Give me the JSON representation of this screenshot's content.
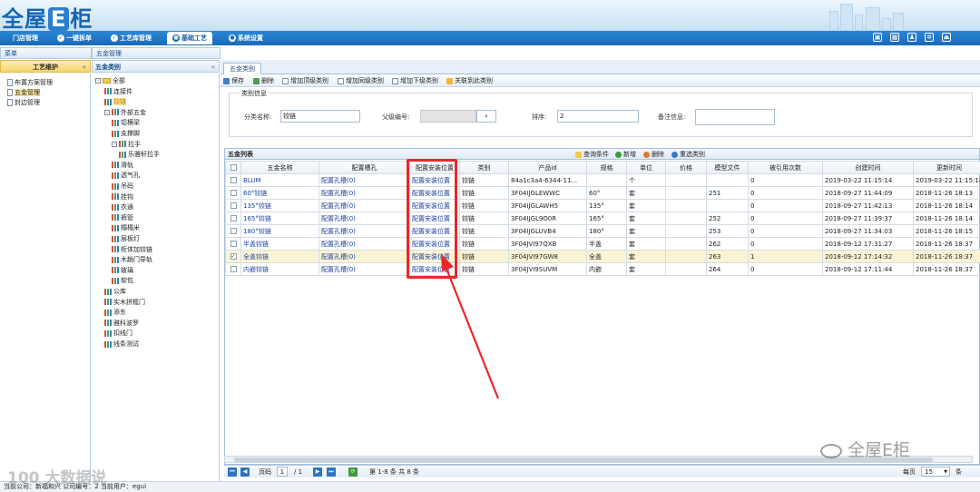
{
  "app": {
    "logo": "全屋E柜",
    "nav_tabs": [
      {
        "label": "门店管理",
        "icon": ""
      },
      {
        "label": "一键拆单",
        "icon": "check-icon"
      },
      {
        "label": "工艺库管理",
        "icon": "check-icon"
      },
      {
        "label": "基础工艺",
        "icon": "gear-icon",
        "active": true
      },
      {
        "label": "系统设置",
        "icon": "settings-icon"
      }
    ],
    "top_icons": [
      "layout-icon",
      "calendar-icon",
      "user-icon",
      "gear-icon",
      "exit-icon"
    ]
  },
  "left": {
    "menu_header": "菜单",
    "section": "工艺维护",
    "items": [
      {
        "label": "布置方案管理",
        "selected": false
      },
      {
        "label": "五金管理",
        "selected": true
      },
      {
        "label": "封边管理",
        "selected": false
      }
    ]
  },
  "tree": {
    "breadcrumb": "五金管理",
    "section": "五金类别",
    "nodes": [
      {
        "label": "全部",
        "level": 0,
        "toggle": "-",
        "icon": "folder"
      },
      {
        "label": "连接件",
        "level": 1,
        "toggle": "",
        "icon": "bars"
      },
      {
        "label": "铰链",
        "level": 1,
        "toggle": "",
        "icon": "bars",
        "selected": true
      },
      {
        "label": "外部五金",
        "level": 1,
        "toggle": "-",
        "icon": "bars"
      },
      {
        "label": "铝横梁",
        "level": 2,
        "toggle": "",
        "icon": "bars"
      },
      {
        "label": "支撑脚",
        "level": 2,
        "toggle": "",
        "icon": "bars"
      },
      {
        "label": "拉手",
        "level": 2,
        "toggle": "-",
        "icon": "bars"
      },
      {
        "label": "乐雅轩拉手",
        "level": 3,
        "toggle": "",
        "icon": "bars"
      },
      {
        "label": "滑轨",
        "level": 2,
        "toggle": "",
        "icon": "bars"
      },
      {
        "label": "透气孔",
        "level": 2,
        "toggle": "",
        "icon": "bars"
      },
      {
        "label": "吊码",
        "level": 2,
        "toggle": "",
        "icon": "bars"
      },
      {
        "label": "挂钩",
        "level": 2,
        "toggle": "",
        "icon": "bars"
      },
      {
        "label": "衣通",
        "level": 2,
        "toggle": "",
        "icon": "bars"
      },
      {
        "label": "裤管",
        "level": 2,
        "toggle": "",
        "icon": "bars"
      },
      {
        "label": "榻榻米",
        "level": 2,
        "toggle": "",
        "icon": "bars"
      },
      {
        "label": "层板灯",
        "level": 2,
        "toggle": "",
        "icon": "bars"
      },
      {
        "label": "柜体加铰链",
        "level": 2,
        "toggle": "",
        "icon": "bars"
      },
      {
        "label": "木趟门导轨",
        "level": 2,
        "toggle": "",
        "icon": "bars"
      },
      {
        "label": "玻璃",
        "level": 2,
        "toggle": "",
        "icon": "bars"
      },
      {
        "label": "软包",
        "level": 2,
        "toggle": "",
        "icon": "bars"
      },
      {
        "label": "公库",
        "level": 1,
        "toggle": "",
        "icon": "bars"
      },
      {
        "label": "实木拼框门",
        "level": 1,
        "toggle": "",
        "icon": "bars"
      },
      {
        "label": "添东",
        "level": 1,
        "toggle": "",
        "icon": "bars"
      },
      {
        "label": "雅科波罗",
        "level": 1,
        "toggle": "",
        "icon": "bars"
      },
      {
        "label": "扣线门",
        "level": 1,
        "toggle": "",
        "icon": "bars"
      },
      {
        "label": "线条测试",
        "level": 1,
        "toggle": "",
        "icon": "bars"
      }
    ]
  },
  "main": {
    "tab": "五金类别",
    "toolbar": [
      "保存",
      "删除",
      "增加顶级类别",
      "增加同级类别",
      "增加下级类别",
      "关联到此类别"
    ],
    "form": {
      "legend": "类别信息",
      "name_label": "分类名称:",
      "name_value": "铰链",
      "parent_label": "父级编号:",
      "parent_value": "",
      "sort_label": "排序:",
      "sort_value": "2",
      "remark_label": "备注信息:",
      "remark_value": ""
    },
    "grid": {
      "title": "五金列表",
      "actions": [
        "查询条件",
        "新增",
        "删除",
        "重选类别"
      ],
      "columns": [
        "",
        "五金名称",
        "配置槽孔",
        "配置安装位置",
        "类别",
        "产品id",
        "规格",
        "单位",
        "价格",
        "模型文件",
        "被引用次数",
        "创建时间",
        "更新时间"
      ],
      "rows": [
        {
          "checked": false,
          "cells": [
            "BLUM",
            "配置孔槽(0)",
            "配置安装位置",
            "铰链",
            "84a1c3a4-6344-11...",
            "",
            "个",
            "",
            "",
            "0",
            "2019-03-22 11:15:14",
            "2019-03-22 11:15:14"
          ]
        },
        {
          "checked": false,
          "cells": [
            "60°铰链",
            "配置孔槽(0)",
            "配置安装位置",
            "铰链",
            "3F04IJGLEWWC",
            "60°",
            "套",
            "",
            "251",
            "0",
            "2018-09-27 11:44:09",
            "2018-11-26 18:13"
          ]
        },
        {
          "checked": false,
          "cells": [
            "135°铰链",
            "配置孔槽(0)",
            "配置安装位置",
            "铰链",
            "3F04IJGLAWH5",
            "135°",
            "套",
            "",
            "",
            "0",
            "2018-09-27 11:42:13",
            "2018-11-26 18:14"
          ]
        },
        {
          "checked": false,
          "cells": [
            "165°铰链",
            "配置孔槽(0)",
            "配置安装位置",
            "铰链",
            "3F04IJGL9O0R",
            "165°",
            "套",
            "",
            "252",
            "0",
            "2018-09-27 11:39:37",
            "2018-11-26 18:14"
          ]
        },
        {
          "checked": false,
          "cells": [
            "180°铰链",
            "配置孔槽(0)",
            "配置安装位置",
            "铰链",
            "3F04IJGLUVB4",
            "180°",
            "套",
            "",
            "253",
            "0",
            "2018-09-27 11:34:03",
            "2018-11-26 18:15"
          ]
        },
        {
          "checked": false,
          "cells": [
            "半盖铰链",
            "配置孔槽(0)",
            "配置安装位置",
            "铰链",
            "3F04JVI97QXB",
            "半盖",
            "套",
            "",
            "262",
            "0",
            "2018-09-12 17:31:27",
            "2018-11-26 18:37"
          ]
        },
        {
          "checked": true,
          "cells": [
            "全盖铰链",
            "配置孔槽(0)",
            "配置安装位置",
            "铰链",
            "3F04JVI97GW8",
            "全盖",
            "套",
            "",
            "263",
            "1",
            "2018-09-12 17:14:32",
            "2018-11-26 18:37"
          ]
        },
        {
          "checked": false,
          "cells": [
            "内嵌铰链",
            "配置孔槽(0)",
            "配置安装位置",
            "铰链",
            "3F04JVI9SUVM",
            "内嵌",
            "套",
            "",
            "264",
            "0",
            "2018-09-12 17:11:44",
            "2018-11-26 18:37"
          ]
        }
      ]
    },
    "pager": {
      "page_label": "页码",
      "page": "1",
      "total_pages": "/ 1",
      "range_text": "第 1-8 条  共 8 条",
      "per_page_label": "每页",
      "per_page": "15",
      "per_page_suffix": "条"
    }
  },
  "status": {
    "text": "当前公司：新福和兴   公司编号：2   当前用户：egui"
  },
  "watermarks": {
    "left": "100 大数据说",
    "right": "全屋E柜"
  },
  "colors": {
    "brand": "#1a6ab8",
    "highlight": "#e8282b",
    "selected_row": "#fbf4d4"
  }
}
